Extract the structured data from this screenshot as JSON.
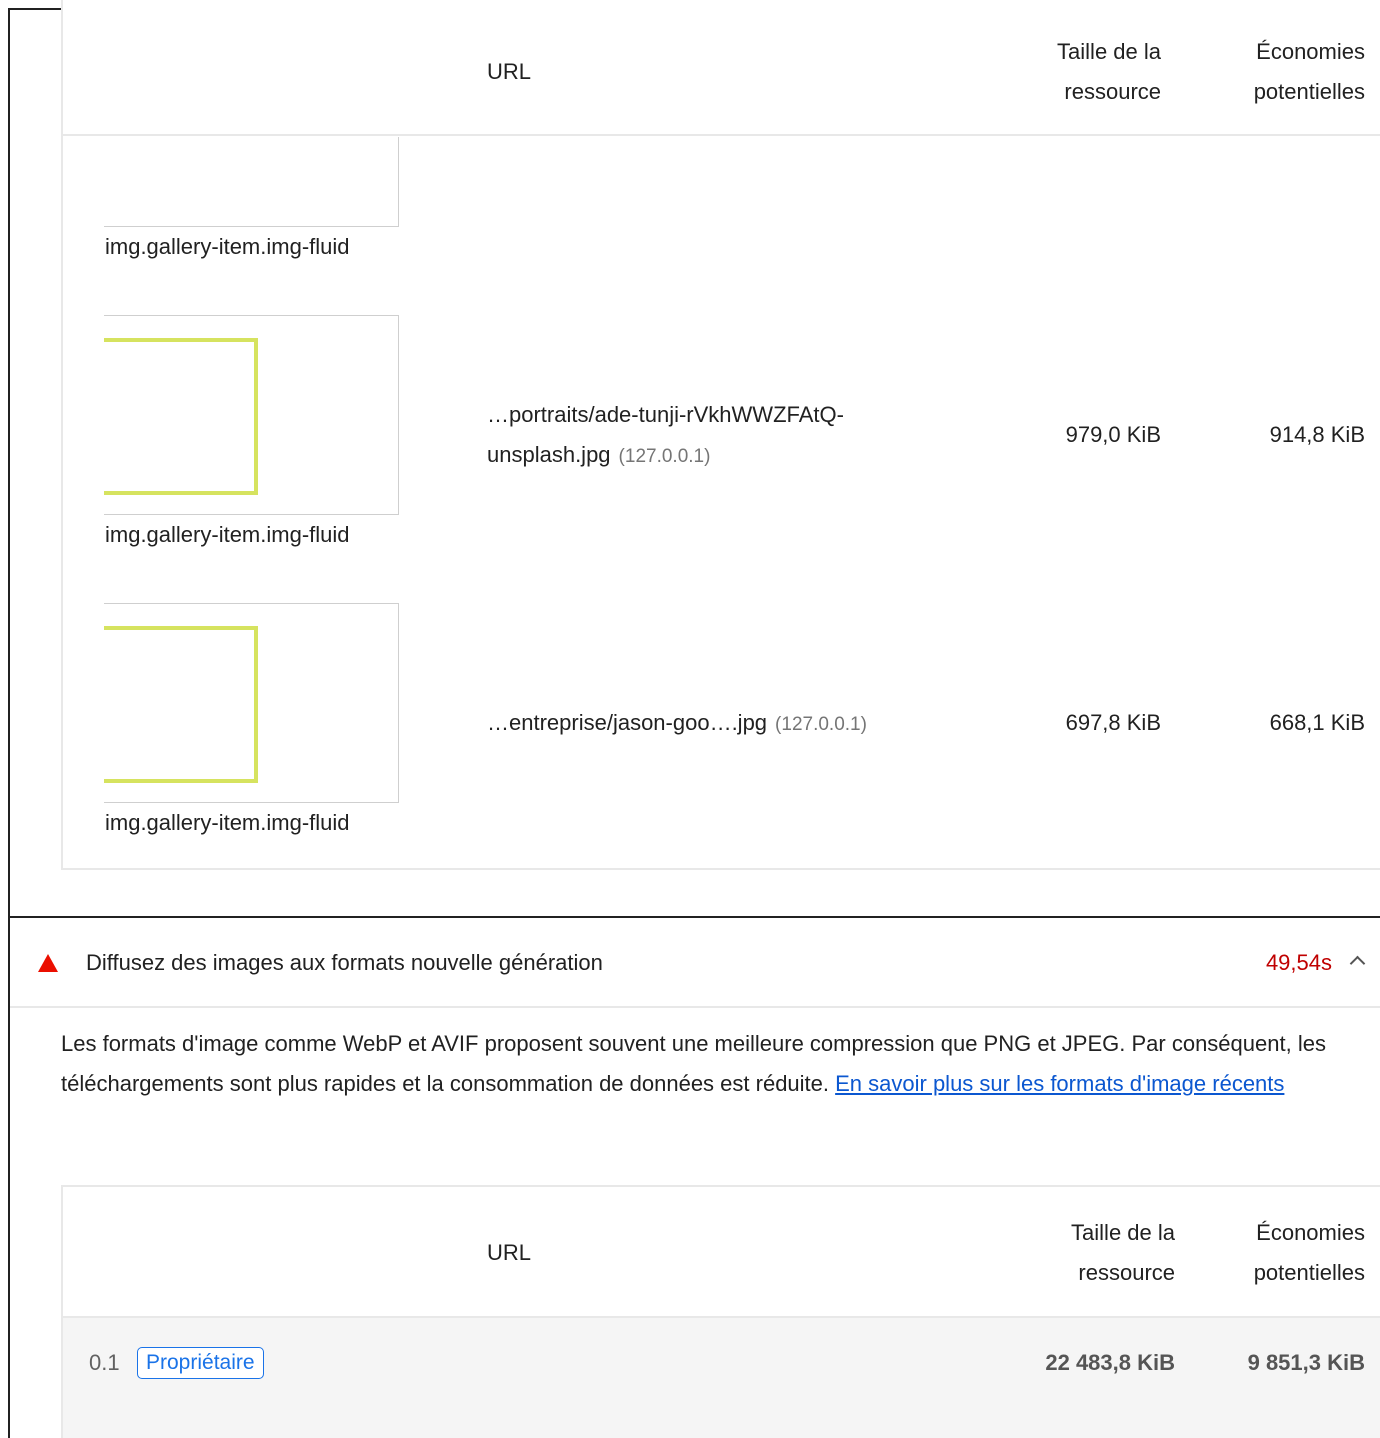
{
  "table1": {
    "headers": {
      "url": "URL",
      "resource_size": [
        "Taille de la",
        "ressource"
      ],
      "potential_savings": [
        "Économies",
        "potentielles"
      ]
    },
    "rows": [
      {
        "node": "img.gallery-item.img-fluid"
      },
      {
        "node": "img.gallery-item.img-fluid",
        "url_line1": "…portraits/ade-tunji-rVkhWWZFAtQ-",
        "url_line2": "unsplash.jpg",
        "host": "(127.0.0.1)",
        "size": "979,0 KiB",
        "savings": "914,8 KiB"
      },
      {
        "node": "img.gallery-item.img-fluid",
        "url_line1": "…entreprise/jason-goo….jpg",
        "host": "(127.0.0.1)",
        "size": "697,8 KiB",
        "savings": "668,1 KiB"
      }
    ]
  },
  "audit": {
    "title": "Diffusez des images aux formats nouvelle génération",
    "score": "49,54s",
    "description": "Les formats d'image comme WebP et AVIF proposent souvent une meilleure compression que PNG et JPEG. Par conséquent, les téléchargements sont plus rapides et la consommation de données est réduite. ",
    "link_text": "En savoir plus sur les formats d'image récents"
  },
  "table2": {
    "headers": {
      "url": "URL",
      "resource_size": [
        "Taille de la",
        "ressource"
      ],
      "potential_savings": [
        "Économies",
        "potentielles"
      ]
    },
    "group": {
      "score": "0.1",
      "badge": "Propriétaire",
      "size": "22 483,8 KiB",
      "savings": "9 851,3 KiB"
    }
  },
  "colors": {
    "warning": "#eb0f00",
    "score": "#c00000",
    "link": "#0b57d0",
    "badge": "#1a73e8",
    "thumbnail_frame": "#d6e35f"
  }
}
